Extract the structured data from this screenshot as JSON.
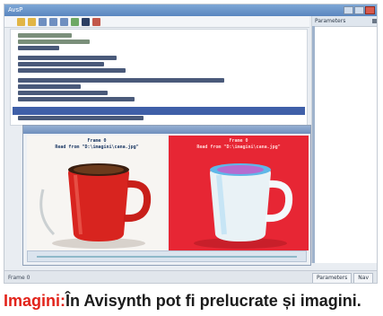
{
  "window": {
    "title": "AvsP"
  },
  "script_panel": {
    "title": "Parameters"
  },
  "preview": {
    "left_caption_1": "Frame 0",
    "left_caption_2": "Read from \"D:\\imagini\\cana.jpg\"",
    "right_caption_1": "Frame 0",
    "right_caption_2": "Read from \"D:\\imagini\\cana.jpg\""
  },
  "status_bar": {
    "text": "Frame 0",
    "tab_1": "Parameters",
    "tab_2": "Nav"
  },
  "figure_caption": {
    "label": "Imagini:",
    "text": "În Avisynth pot fi prelucrate și imagini."
  },
  "colors": {
    "caption_label": "#e2231a",
    "right_image_bg": "#e72634",
    "selection": "#3f5fa8"
  },
  "icons": [
    "new-file-icon",
    "open-folder-icon",
    "save-icon",
    "undo-icon",
    "redo-icon",
    "play-icon",
    "stop-icon",
    "settings-icon"
  ]
}
